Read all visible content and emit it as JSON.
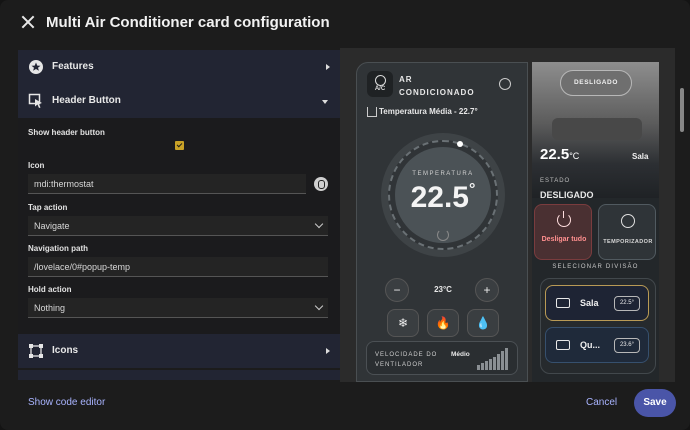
{
  "dialog": {
    "title": "Multi Air Conditioner card configuration"
  },
  "editor": {
    "sections": {
      "features": {
        "label": "Features"
      },
      "header_button": {
        "label": "Header Button"
      },
      "icons": {
        "label": "Icons"
      }
    },
    "show_header_button": {
      "label": "Show header button",
      "checked": true
    },
    "icon": {
      "label": "Icon",
      "value": "mdi:thermostat"
    },
    "tap_action": {
      "label": "Tap action",
      "value": "Navigate"
    },
    "navigation_path": {
      "label": "Navigation path",
      "value": "/lovelace/0#popup-temp"
    },
    "hold_action": {
      "label": "Hold action",
      "value": "Nothing"
    }
  },
  "preview": {
    "logo_text": "A/C",
    "title": "AR CONDICIONADO",
    "average_temp": "Temperatura Média - 22.7°",
    "dial": {
      "caption": "TEMPERATURA",
      "value": "22.5",
      "unit": "°"
    },
    "minus": "−",
    "plus": "+",
    "setpoint": "23°C",
    "modes": [
      {
        "icon": "snowflake-icon",
        "glyph": "❄"
      },
      {
        "icon": "flame-icon",
        "glyph": "🔥"
      },
      {
        "icon": "water-drop-icon",
        "glyph": "💧"
      }
    ],
    "fan": {
      "label": "VELOCIDADE DO VENTILADOR",
      "level": "Médio"
    },
    "status_pill": "DESLIGADO",
    "room_temp": "22.5",
    "room_temp_unit": "°C",
    "room_name": "Sala",
    "estado_caption": "ESTADO",
    "estado_value": "DESLIGADO",
    "off_button": "Desligar tudo",
    "timer_button": "TEMPORIZADOR",
    "select_caption": "SELECIONAR DIVISÃO",
    "rooms": [
      {
        "name": "Sala",
        "temp": "22.5°"
      },
      {
        "name": "Qu...",
        "temp": "23.6°"
      }
    ]
  },
  "footer": {
    "code_editor": "Show code editor",
    "cancel": "Cancel",
    "save": "Save"
  }
}
